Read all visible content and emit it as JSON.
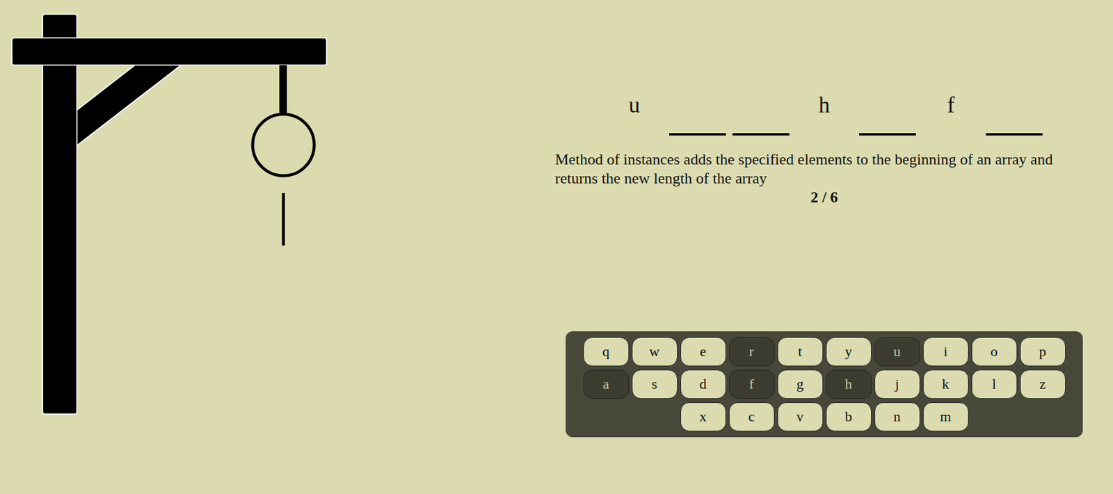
{
  "hangman": {
    "parts": [
      {
        "name": "head",
        "shown": true
      },
      {
        "name": "body",
        "shown": true
      },
      {
        "name": "left-arm",
        "shown": false
      },
      {
        "name": "right-arm",
        "shown": false
      },
      {
        "name": "left-leg",
        "shown": false
      },
      {
        "name": "right-leg",
        "shown": false
      }
    ]
  },
  "word": [
    {
      "text": "u",
      "revealed": true
    },
    {
      "text": "",
      "revealed": false
    },
    {
      "text": "",
      "revealed": false
    },
    {
      "text": "h",
      "revealed": true
    },
    {
      "text": "",
      "revealed": false
    },
    {
      "text": "f",
      "revealed": true
    },
    {
      "text": "",
      "revealed": false
    }
  ],
  "hint": "Method of instances adds the specified elements to the beginning of an array and returns the new length of the array",
  "counter": "2 / 6",
  "keyboard": {
    "rows": [
      [
        {
          "label": "q",
          "used": false
        },
        {
          "label": "w",
          "used": false
        },
        {
          "label": "e",
          "used": false
        },
        {
          "label": "r",
          "used": true
        },
        {
          "label": "t",
          "used": false
        },
        {
          "label": "y",
          "used": false
        },
        {
          "label": "u",
          "used": true
        },
        {
          "label": "i",
          "used": false
        },
        {
          "label": "o",
          "used": false
        },
        {
          "label": "p",
          "used": false
        }
      ],
      [
        {
          "label": "a",
          "used": true
        },
        {
          "label": "s",
          "used": false
        },
        {
          "label": "d",
          "used": false
        },
        {
          "label": "f",
          "used": true
        },
        {
          "label": "g",
          "used": false
        },
        {
          "label": "h",
          "used": true
        },
        {
          "label": "j",
          "used": false
        },
        {
          "label": "k",
          "used": false
        },
        {
          "label": "l",
          "used": false
        },
        {
          "label": "z",
          "used": false
        }
      ],
      [
        {
          "label": "x",
          "used": false
        },
        {
          "label": "c",
          "used": false
        },
        {
          "label": "v",
          "used": false
        },
        {
          "label": "b",
          "used": false
        },
        {
          "label": "n",
          "used": false
        },
        {
          "label": "m",
          "used": false
        }
      ]
    ]
  }
}
